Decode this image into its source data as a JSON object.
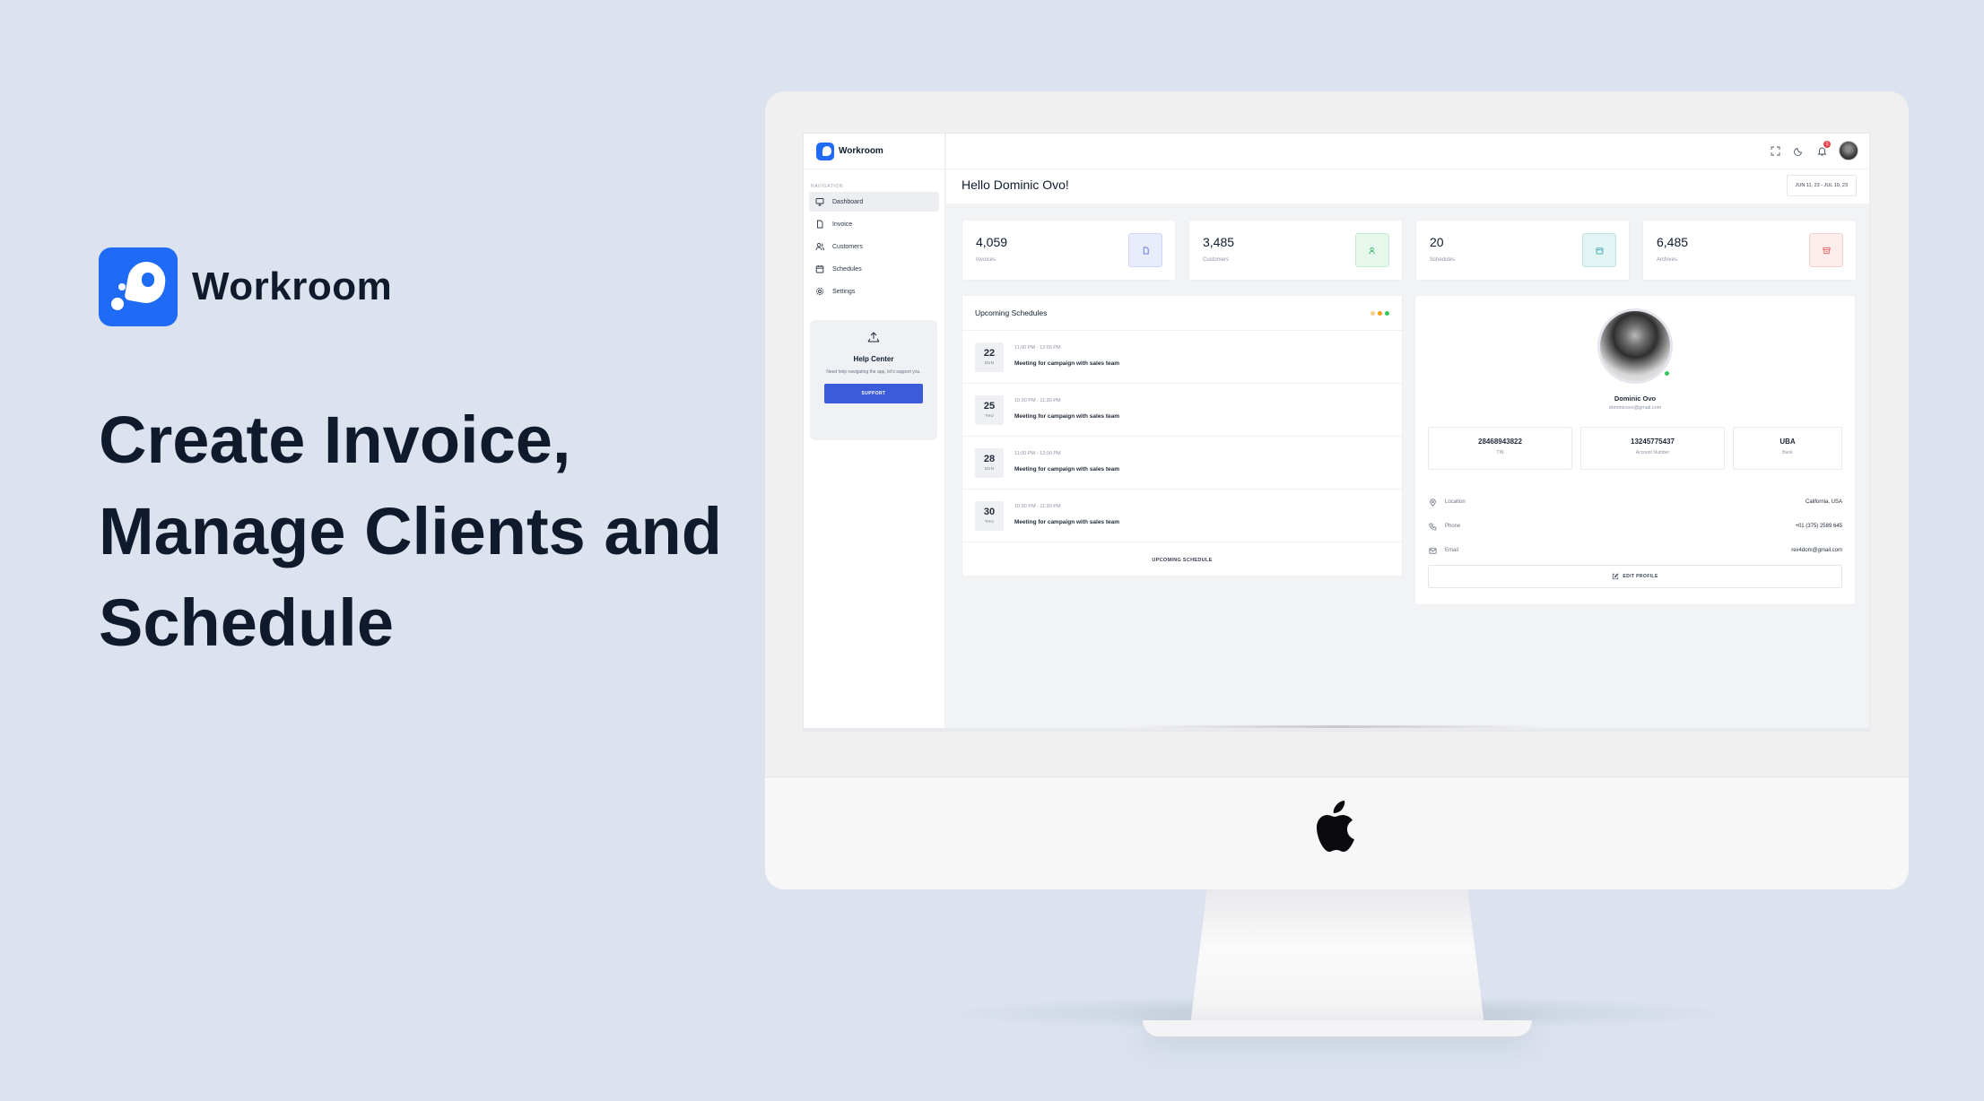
{
  "brand": {
    "name": "Workroom"
  },
  "headline": {
    "line1": "Create Invoice,",
    "line2": "Manage Clients and",
    "line3": "Schedule"
  },
  "app": {
    "name": "Workroom",
    "nav_section": "NAVIGATION",
    "nav": [
      {
        "label": "Dashboard",
        "icon": "monitor-icon",
        "active": true
      },
      {
        "label": "Invoice",
        "icon": "file-icon"
      },
      {
        "label": "Customers",
        "icon": "users-icon"
      },
      {
        "label": "Schedules",
        "icon": "calendar-icon"
      },
      {
        "label": "Settings",
        "icon": "gear-icon"
      }
    ],
    "help": {
      "title": "Help Center",
      "description": "Need help navigating the app, let's support you.",
      "button": "SUPPORT"
    },
    "topbar": {
      "notification_count": "1"
    },
    "greeting": "Hello Dominic Ovo!",
    "date_range": "JUN 11, 23 - JUL 10, 23",
    "stats": [
      {
        "value": "4,059",
        "label": "Invoices",
        "icon": "file-icon",
        "color": "#5b6fd6",
        "bg": "#e9ecfb"
      },
      {
        "value": "3,485",
        "label": "Customers",
        "icon": "users-icon",
        "color": "#35b46b",
        "bg": "#e6f7ec"
      },
      {
        "value": "20",
        "label": "Schedules",
        "icon": "calendar-icon",
        "color": "#3aa7a8",
        "bg": "#e3f4f4"
      },
      {
        "value": "6,485",
        "label": "Archives",
        "icon": "archive-icon",
        "color": "#e05d5d",
        "bg": "#fcecec"
      }
    ],
    "schedules": {
      "title": "Upcoming Schedules",
      "dot_colors": [
        "#f5d08a",
        "#f59e0b",
        "#34c759"
      ],
      "items": [
        {
          "day_num": "22",
          "day": "SUN",
          "time": "11:00 PM - 12:00 PM",
          "title": "Meeting for campaign with sales team"
        },
        {
          "day_num": "25",
          "day": "THU",
          "time": "10:30 PM - 11:30 PM",
          "title": "Meeting for campaign with sales team"
        },
        {
          "day_num": "28",
          "day": "SUN",
          "time": "11:00 PM - 12:00 PM",
          "title": "Meeting for campaign with sales team"
        },
        {
          "day_num": "30",
          "day": "THU",
          "time": "10:30 PM - 11:30 PM",
          "title": "Meeting for campaign with sales team"
        }
      ],
      "footer": "UPCOMING SCHEDULE"
    },
    "profile": {
      "name": "Dominic Ovo",
      "email": "dominicovo@gmail.com",
      "cards": [
        {
          "value": "28468943822",
          "label": "TIN"
        },
        {
          "value": "13245775437",
          "label": "Account Number"
        },
        {
          "value": "UBA",
          "label": "Bank"
        }
      ],
      "details": [
        {
          "label": "Location",
          "value": "California, USA",
          "icon": "location-pin-icon"
        },
        {
          "label": "Phone",
          "value": "+01 (375) 2589 645",
          "icon": "phone-icon"
        },
        {
          "label": "Email",
          "value": "rex4dom@gmail.com",
          "icon": "mail-icon"
        }
      ],
      "edit_button": "EDIT PROFILE"
    }
  }
}
